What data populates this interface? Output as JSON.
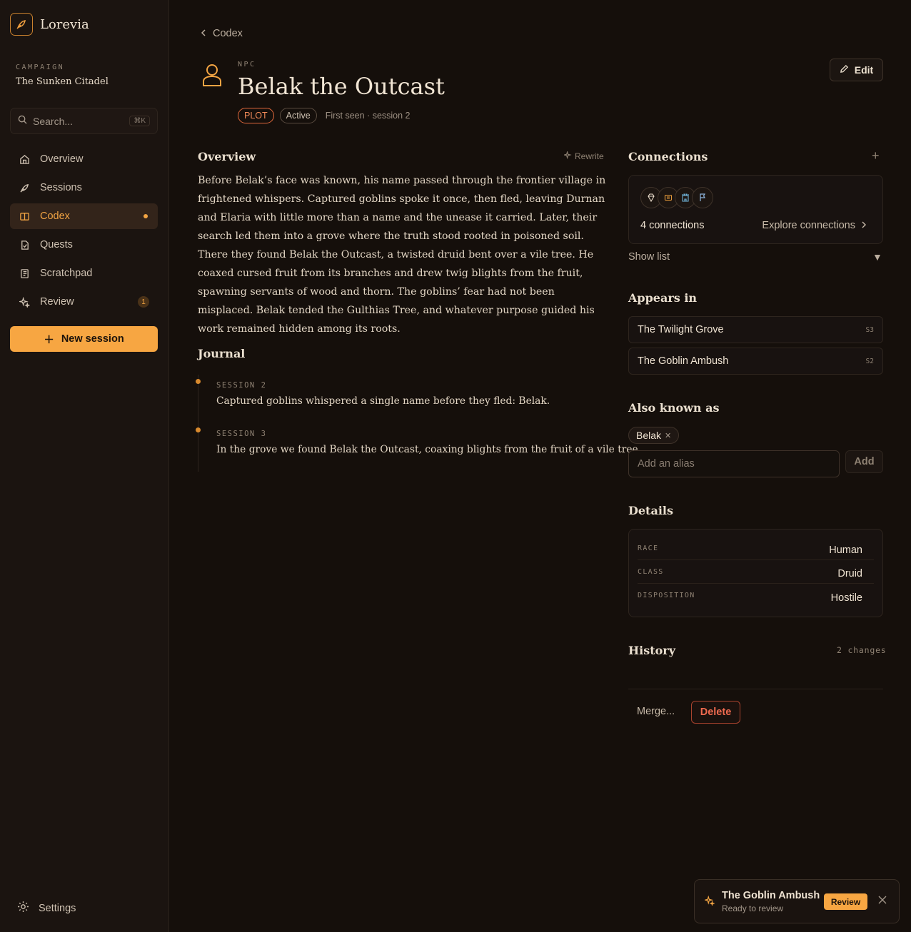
{
  "app": {
    "name": "Lorevia"
  },
  "campaign": {
    "label": "CAMPAIGN",
    "name": "The Sunken Citadel"
  },
  "search": {
    "placeholder": "Search...",
    "shortcut": "⌘K"
  },
  "nav": [
    {
      "label": "Overview",
      "icon": "home-icon"
    },
    {
      "label": "Sessions",
      "icon": "quill-icon"
    },
    {
      "label": "Codex",
      "icon": "book-icon",
      "active": true
    },
    {
      "label": "Quests",
      "icon": "scroll-icon"
    },
    {
      "label": "Scratchpad",
      "icon": "notepad-icon"
    },
    {
      "label": "Review",
      "icon": "sparkle-icon",
      "badge": "1"
    }
  ],
  "new_session": {
    "label": "New session"
  },
  "settings": {
    "label": "Settings"
  },
  "breadcrumb": {
    "back_label": "Codex"
  },
  "entity": {
    "kind": "NPC",
    "name": "Belak the Outcast",
    "tag_plot": "PLOT",
    "tag_status": "Active",
    "first_seen": "First seen · session 2"
  },
  "edit": {
    "label": "Edit"
  },
  "overview": {
    "heading": "Overview",
    "rewrite_label": "Rewrite",
    "text": "Before Belak’s face was known, his name passed through the frontier village in frightened whispers. Captured goblins spoke it once, then fled, leaving Durnan and Elaria with little more than a name and the unease it carried. Later, their search led them into a grove where the truth stood rooted in poisoned soil. There they found Belak the Outcast, a twisted druid bent over a vile tree. He coaxed cursed fruit from its branches and drew twig blights from the fruit, spawning servants of wood and thorn. The goblins’ fear had not been misplaced. Belak tended the Gulthias Tree, and whatever purpose guided his work remained hidden among its roots."
  },
  "journal": {
    "heading": "Journal",
    "entries": [
      {
        "session": "SESSION 2",
        "text": "Captured goblins whispered a single name before they fled: Belak."
      },
      {
        "session": "SESSION 3",
        "text": "In the grove we found Belak the Outcast, coaxing blights from the fruit of a vile tree."
      }
    ]
  },
  "connections": {
    "heading": "Connections",
    "count": "4 connections",
    "explore_label": "Explore connections",
    "show_list": "Show list"
  },
  "appears_in": {
    "heading": "Appears in",
    "items": [
      {
        "name": "The Twilight Grove",
        "session": "S3"
      },
      {
        "name": "The Goblin Ambush",
        "session": "S2"
      }
    ]
  },
  "aliases": {
    "heading": "Also known as",
    "items": [
      "Belak"
    ],
    "input_placeholder": "Add an alias",
    "add_label": "Add"
  },
  "details": {
    "heading": "Details",
    "rows": [
      {
        "key": "RACE",
        "value": "Human"
      },
      {
        "key": "CLASS",
        "value": "Druid"
      },
      {
        "key": "DISPOSITION",
        "value": "Hostile"
      }
    ]
  },
  "history": {
    "heading": "History",
    "count": "2 changes"
  },
  "actions": {
    "merge_label": "Merge...",
    "delete_label": "Delete"
  },
  "toast": {
    "title": "The Goblin Ambush",
    "subtitle": "Ready to review",
    "review_label": "Review"
  },
  "colors": {
    "accent": "#f7a642",
    "background": "#150f0b",
    "danger": "#ef6a4f"
  }
}
